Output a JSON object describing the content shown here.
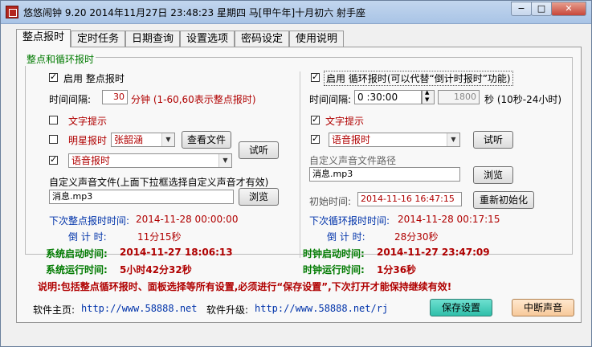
{
  "window": {
    "title": "悠悠闹钟 9.20 2014年11月27日 23:48:23 星期四 马[甲午年]十月初六 射手座",
    "minimize": "−",
    "maximize": "□",
    "close": "✕"
  },
  "tabs": [
    "整点报时",
    "定时任务",
    "日期查询",
    "设置选项",
    "密码设定",
    "使用说明"
  ],
  "group_title": "整点和循环报时",
  "left": {
    "enable_label": "启用 整点报时",
    "interval_label": "时间间隔:",
    "interval_value": "30",
    "interval_unit": "分钟 (1-60,60表示整点报时)",
    "text_tip_label": "文字提示",
    "star_label": "明星报时",
    "star_value": "张韶涵",
    "view_file_btn": "查看文件",
    "voice_value": "语音报时",
    "test_btn": "试听",
    "custom_label": "自定义声音文件(上面下拉框选择自定义声音才有效)",
    "custom_value": "消息.mp3",
    "browse_btn": "浏览",
    "next_label": "下次整点报时时间:",
    "next_value": "2014-11-28 00:00:00",
    "countdown_label": "倒 计 时:",
    "countdown_value": "11分15秒"
  },
  "right": {
    "enable_label": "启用 循环报时(可以代替“倒计时报时”功能)",
    "interval_label": "时间间隔:",
    "interval_value": "0 :30:00",
    "seconds_value": "1800",
    "seconds_unit": "秒 (10秒-24小时)",
    "text_tip_label": "文字提示",
    "voice_value": "语音报时",
    "test_btn": "试听",
    "custom_path_label": "自定义声音文件路径",
    "custom_value": "消息.mp3",
    "browse_btn": "浏览",
    "init_label": "初始时间:",
    "init_value": "2014-11-16 16:47:15",
    "reinit_btn": "重新初始化",
    "next_label": "下次循环报时时间:",
    "next_value": "2014-11-28 00:17:15",
    "countdown_label": "倒 计 时:",
    "countdown_value": "28分30秒"
  },
  "status": {
    "sys_start_label": "系统启动时间:",
    "sys_start_value": "2014-11-27 18:06:13",
    "sys_run_label": "系统运行时间:",
    "sys_run_value": "5小时42分32秒",
    "clock_start_label": "时钟启动时间:",
    "clock_start_value": "2014-11-27 23:47:09",
    "clock_run_label": "时钟运行时间:",
    "clock_run_value": "1分36秒"
  },
  "note": "说明:包括整点循环报时、面板选择等所有设置,必须进行“保存设置”,下次打开才能保持继续有效!",
  "footer": {
    "home_label": "软件主页:",
    "home_url": "http://www.58888.net",
    "upgrade_label": "软件升级:",
    "upgrade_url": "http://www.58888.net/rj",
    "save_btn": "保存设置",
    "stop_btn": "中断声音"
  }
}
